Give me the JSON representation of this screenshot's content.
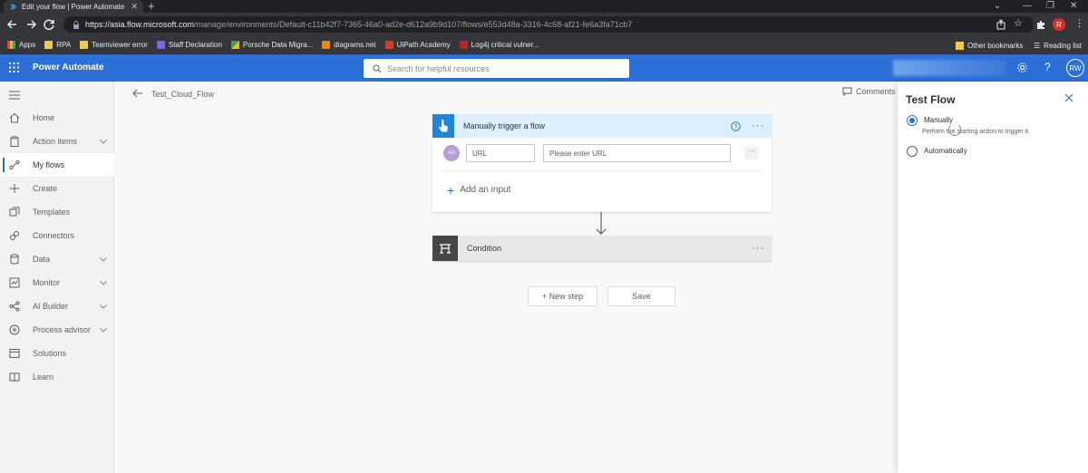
{
  "browser": {
    "tab_title": "Edit your flow | Power Automate",
    "url_host": "https://asia.flow.microsoft.com",
    "url_path": "/manage/environments/Default-c11b42f7-7365-46a0-ad2e-d612a9b9d107/flows/e553d48a-3316-4c68-af21-fe6a3fa71cb7",
    "profile_initial": "R",
    "bookmarks": [
      "Apps",
      "RPA",
      "Teamviewer error",
      "Staff Declaration",
      "Porsche Data Migra...",
      "diagrams.net",
      "UiPath Academy",
      "Log4j critical vulner..."
    ],
    "other_bookmarks": "Other bookmarks",
    "reading_list": "Reading list"
  },
  "header": {
    "app_name": "Power Automate",
    "search_placeholder": "Search for helpful resources",
    "avatar_initials": "RW"
  },
  "nav": {
    "items": [
      "Home",
      "Action items",
      "My flows",
      "Create",
      "Templates",
      "Connectors",
      "Data",
      "Monitor",
      "AI Builder",
      "Process advisor",
      "Solutions",
      "Learn"
    ],
    "active": "My flows"
  },
  "canvas": {
    "flow_name": "Test_Cloud_Flow",
    "comments_label": "Comments",
    "trigger": {
      "title": "Manually trigger a flow",
      "field_label": "URL",
      "field_placeholder": "Please enter URL",
      "avatar_text": "AA",
      "add_input_label": "Add an input"
    },
    "condition_title": "Condition",
    "new_step_label": "+ New step",
    "save_label": "Save"
  },
  "panel": {
    "title": "Test Flow",
    "option_manual": "Manually",
    "option_manual_desc": "Perform the starting action to trigger it.",
    "option_auto": "Automatically",
    "selected": "Manually"
  },
  "colors": {
    "accent": "#2c6fd6",
    "trigger_blue": "#1f85d8",
    "condition_dark": "#484644"
  }
}
